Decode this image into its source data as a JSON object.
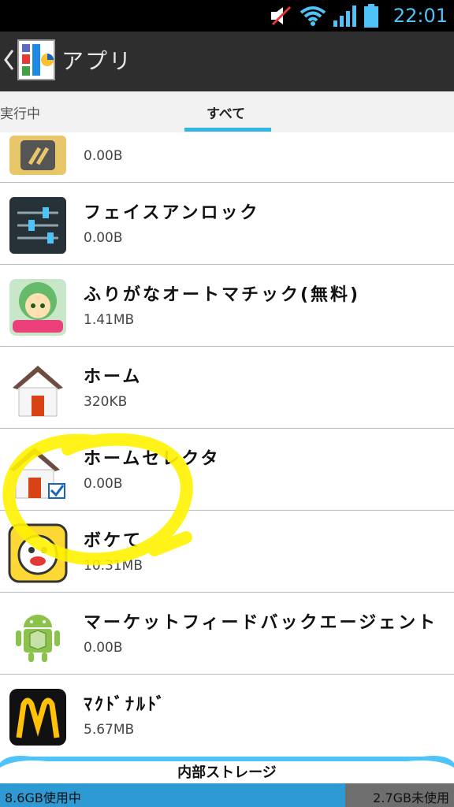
{
  "status": {
    "time": "22:01"
  },
  "header": {
    "title": "アプリ"
  },
  "tabs": [
    {
      "label": "実行中"
    },
    {
      "label": "すべて"
    }
  ],
  "apps": [
    {
      "name": "",
      "size": "0.00B",
      "icon": "yellow-slash-app-icon"
    },
    {
      "name": "フェイスアンロック",
      "size": "0.00B",
      "icon": "settings-sliders-icon"
    },
    {
      "name": "ふりがなオートマチック(無料)",
      "size": "1.41MB",
      "icon": "anime-character-icon"
    },
    {
      "name": "ホーム",
      "size": "320KB",
      "icon": "house-icon"
    },
    {
      "name": "ホームセレクタ",
      "size": "0.00B",
      "icon": "house-check-icon"
    },
    {
      "name": "ボケて",
      "size": "10.31MB",
      "icon": "bokete-face-icon"
    },
    {
      "name": "マーケットフィードバックエージェント",
      "size": "0.00B",
      "icon": "android-package-icon"
    },
    {
      "name": "ﾏｸﾄﾞﾅﾙﾄﾞ",
      "size": "5.67MB",
      "icon": "mcdonalds-logo-icon"
    }
  ],
  "storage": {
    "label": "内部ストレージ",
    "used": "8.6GB使用中",
    "free": "2.7GB未使用",
    "used_fraction": 0.76
  },
  "colors": {
    "accent": "#33b5e5",
    "highlight": "#fff200"
  }
}
